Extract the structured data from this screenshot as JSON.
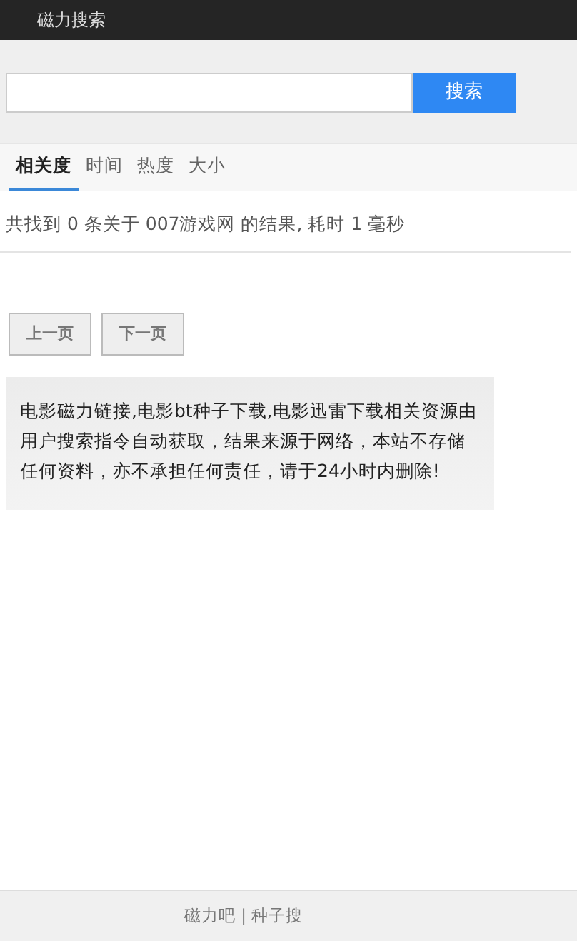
{
  "header": {
    "title": "磁力搜索"
  },
  "search": {
    "button": "搜索"
  },
  "sort_tabs": [
    {
      "label": "相关度",
      "selected": true
    },
    {
      "label": "时间",
      "selected": false
    },
    {
      "label": "热度",
      "selected": false
    },
    {
      "label": "大小",
      "selected": false
    }
  ],
  "result_summary": "共找到 0 条关于 007游戏网 的结果, 耗时 1 毫秒",
  "pagination": [
    "上一页",
    "下一页"
  ],
  "notice": "电影磁力链接,电影bt种子下载,电影迅雷下载相关资源由用户搜索指令自动获取，结果来源于网络，本站不存储任何资料，亦不承担任何责任，请于24小时内删除!",
  "footer": "磁力吧 | 种子搜"
}
